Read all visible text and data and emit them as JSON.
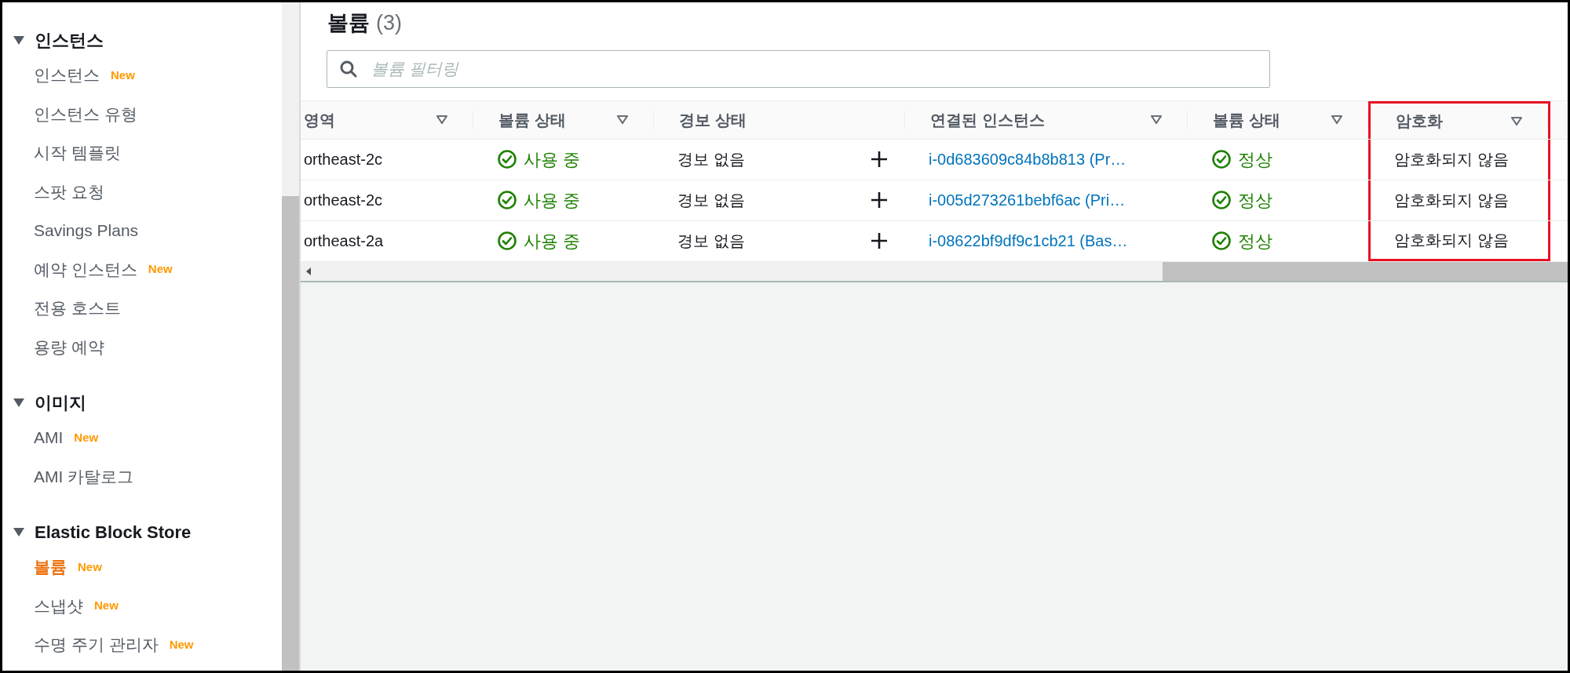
{
  "sidebar": {
    "sections": [
      {
        "title": "인스턴스",
        "expanded": true,
        "items": [
          {
            "label": "인스턴스",
            "badge": "New",
            "selected": false
          },
          {
            "label": "인스턴스 유형",
            "selected": false
          },
          {
            "label": "시작 템플릿",
            "selected": false
          },
          {
            "label": "스팟 요청",
            "selected": false
          },
          {
            "label": "Savings Plans",
            "selected": false
          },
          {
            "label": "예약 인스턴스",
            "badge": "New",
            "selected": false
          },
          {
            "label": "전용 호스트",
            "selected": false
          },
          {
            "label": "용량 예약",
            "selected": false
          }
        ]
      },
      {
        "title": "이미지",
        "expanded": true,
        "items": [
          {
            "label": "AMI",
            "badge": "New",
            "selected": false
          },
          {
            "label": "AMI 카탈로그",
            "selected": false
          }
        ]
      },
      {
        "title": "Elastic Block Store",
        "expanded": true,
        "items": [
          {
            "label": "볼륨",
            "badge": "New",
            "selected": true
          },
          {
            "label": "스냅샷",
            "badge": "New",
            "selected": false
          },
          {
            "label": "수명 주기 관리자",
            "badge": "New",
            "selected": false
          }
        ]
      }
    ]
  },
  "main": {
    "title": "볼륨",
    "count": "(3)",
    "search": {
      "placeholder": "볼륨 필터링"
    },
    "table": {
      "columns": [
        {
          "label": "영역",
          "sortable": true,
          "highlighted": false
        },
        {
          "label": "볼륨 상태",
          "sortable": true,
          "highlighted": false
        },
        {
          "label": "경보 상태",
          "sortable": false,
          "highlighted": false
        },
        {
          "label": "연결된 인스턴스",
          "sortable": true,
          "highlighted": false
        },
        {
          "label": "볼륨 상태",
          "sortable": true,
          "highlighted": false
        },
        {
          "label": "암호화",
          "sortable": true,
          "highlighted": true
        }
      ],
      "rows": [
        [
          {
            "kind": "text",
            "text": "ortheast-2c"
          },
          {
            "kind": "status",
            "text": "사용 중"
          },
          {
            "kind": "alarm",
            "text": "경보 없음"
          },
          {
            "kind": "link",
            "text": "i-0d683609c84b8b813 (Pr…"
          },
          {
            "kind": "status",
            "text": "정상"
          },
          {
            "kind": "text",
            "text": "암호화되지 않음"
          }
        ],
        [
          {
            "kind": "text",
            "text": "ortheast-2c"
          },
          {
            "kind": "status",
            "text": "사용 중"
          },
          {
            "kind": "alarm",
            "text": "경보 없음"
          },
          {
            "kind": "link",
            "text": "i-005d273261bebf6ac (Pri…"
          },
          {
            "kind": "status",
            "text": "정상"
          },
          {
            "kind": "text",
            "text": "암호화되지 않음"
          }
        ],
        [
          {
            "kind": "text",
            "text": "ortheast-2a"
          },
          {
            "kind": "status",
            "text": "사용 중"
          },
          {
            "kind": "alarm",
            "text": "경보 없음"
          },
          {
            "kind": "link",
            "text": "i-08622bf9df9c1cb21 (Bas…"
          },
          {
            "kind": "status",
            "text": "정상"
          },
          {
            "kind": "text",
            "text": "암호화되지 않음"
          }
        ]
      ]
    }
  }
}
